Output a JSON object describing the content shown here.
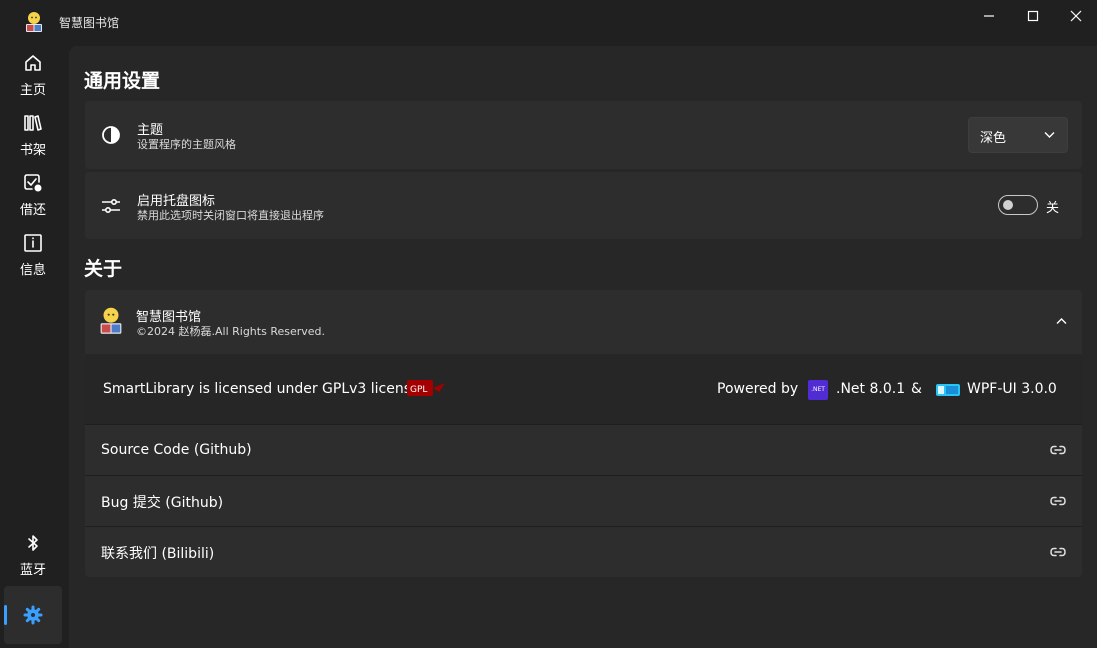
{
  "app": {
    "title": "智慧图书馆"
  },
  "nav": {
    "items": [
      {
        "label": "主页",
        "icon": "home-icon"
      },
      {
        "label": "书架",
        "icon": "bookshelf-icon"
      },
      {
        "label": "借还",
        "icon": "borrow-return-icon"
      },
      {
        "label": "信息",
        "icon": "info-icon"
      }
    ],
    "bottom": [
      {
        "label": "蓝牙",
        "icon": "bluetooth-icon"
      },
      {
        "label": "",
        "icon": "settings-icon",
        "active": true
      }
    ]
  },
  "settings": {
    "general_title": "通用设置",
    "theme": {
      "title": "主题",
      "desc": "设置程序的主题风格",
      "value": "深色"
    },
    "tray": {
      "title": "启用托盘图标",
      "desc": "禁用此选项时关闭窗口将直接退出程序",
      "state_label": "关",
      "enabled": false
    }
  },
  "about": {
    "title": "关于",
    "app_name": "智慧图书馆",
    "copyright": "©2024 赵杨磊.All Rights Reserved.",
    "license_text": "SmartLibrary is licensed under GPLv3 license.",
    "powered_by": "Powered by",
    "dotnet_badge": ".NET",
    "dotnet": ".Net 8.0.1",
    "amp": "&",
    "wpfui": "WPF-UI 3.0.0",
    "links": [
      {
        "label": "Source Code (Github)"
      },
      {
        "label": "Bug 提交 (Github)"
      },
      {
        "label": "联系我们 (Bilibili)"
      }
    ]
  },
  "colors": {
    "accent": "#3aa0ff",
    "dotnet": "#512bd4",
    "card": "#2d2d2d",
    "panel": "#272727"
  }
}
